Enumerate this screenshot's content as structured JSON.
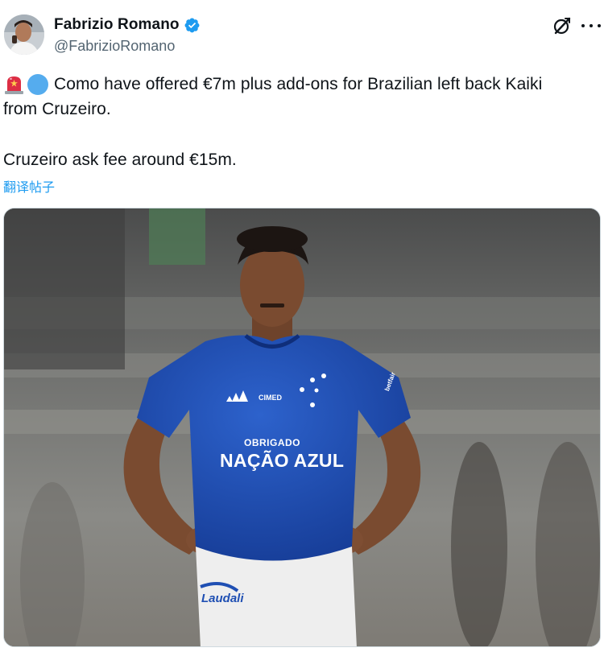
{
  "author": {
    "display_name": "Fabrizio Romano",
    "handle": "@FabrizioRomano",
    "verified": true,
    "avatar_icon": "author-avatar"
  },
  "header_icons": [
    "grok-icon",
    "more-icon"
  ],
  "tweet": {
    "emoji": [
      "police-light-icon",
      "blue-circle-icon"
    ],
    "line1": "Como have offered €7m plus add-ons for Brazilian left back Kaiki",
    "line2": "from Cruzeiro.",
    "line3": "Cruzeiro ask fee around €15m."
  },
  "translate_label": "翻译帖子",
  "photo": {
    "shirt_sponsor_top": "CIMED",
    "shirt_text_small": "OBRIGADO",
    "shirt_text_large": "NAÇÃO AZUL",
    "shorts_sponsor": "Laudali",
    "sleeve_text": "betfair"
  },
  "colors": {
    "text": "#0f1419",
    "secondary": "#536471",
    "link": "#1d9bf0",
    "verified": "#1d9bf0",
    "jersey": "#1f4fb3"
  }
}
